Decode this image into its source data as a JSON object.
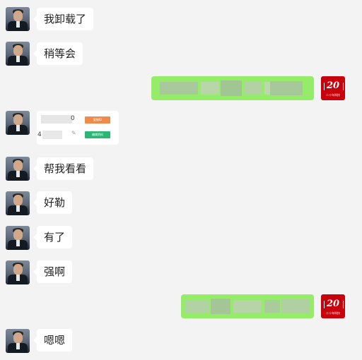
{
  "messages": [
    {
      "side": "left",
      "text": "我卸载了"
    },
    {
      "side": "left",
      "text": "稍等会"
    },
    {
      "side": "right",
      "text": ""
    },
    {
      "side": "left",
      "card": true
    },
    {
      "side": "left",
      "text": "帮我看看"
    },
    {
      "side": "left",
      "text": "好勒"
    },
    {
      "side": "left",
      "text": "有了"
    },
    {
      "side": "left",
      "text": "强啊"
    },
    {
      "side": "right",
      "text": ""
    },
    {
      "side": "left",
      "text": "嗯嗯"
    }
  ],
  "self_badge": {
    "number": "20",
    "caption": "二十年科技"
  },
  "card": {
    "line1_suffix": "0",
    "line2_prefix": "4",
    "button1": "复制ID",
    "button2": "编辑资料",
    "button1_color": "#f08a4b",
    "button2_color": "#2bb673"
  },
  "colors": {
    "background": "#f3f3f3",
    "bubble_other": "#ffffff",
    "bubble_self": "#95ec69",
    "badge": "#c7000b"
  }
}
